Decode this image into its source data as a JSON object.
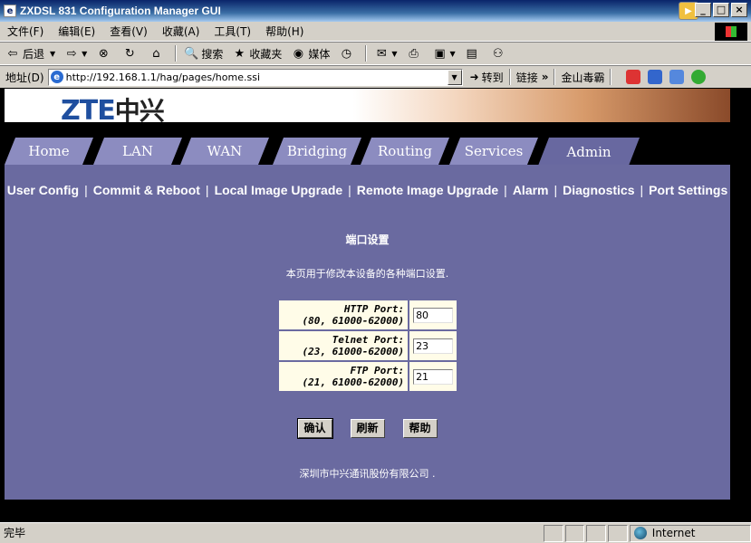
{
  "window": {
    "title": "ZXDSL 831 Configuration Manager GUI",
    "buttons": [
      "_",
      "□",
      "×"
    ]
  },
  "menubar": [
    "文件(F)",
    "编辑(E)",
    "查看(V)",
    "收藏(A)",
    "工具(T)",
    "帮助(H)"
  ],
  "toolbar": {
    "back": "后退",
    "search": "搜索",
    "favorites": "收藏夹",
    "media": "媒体"
  },
  "addressbar": {
    "label": "地址(D)",
    "url": "http://192.168.1.1/hag/pages/home.ssi",
    "go": "转到",
    "links": "链接",
    "jinshan": "金山毒霸"
  },
  "brand": {
    "logo_latin": "ZTE",
    "logo_cn": "中兴"
  },
  "tabs": [
    "Home",
    "LAN",
    "WAN",
    "Bridging",
    "Routing",
    "Services",
    "Admin"
  ],
  "active_tab": "Admin",
  "subnav": [
    "User Config",
    "Commit & Reboot",
    "Local Image Upgrade",
    "Remote Image Upgrade",
    "Alarm",
    "Diagnostics",
    "Port Settings"
  ],
  "page": {
    "title": "端口设置",
    "description": "本页用于修改本设备的各种端口设置.",
    "ports": [
      {
        "name": "HTTP Port:",
        "range": "(80, 61000-62000)",
        "value": "80"
      },
      {
        "name": "Telnet Port:",
        "range": "(23, 61000-62000)",
        "value": "23"
      },
      {
        "name": "FTP Port:",
        "range": "(21, 61000-62000)",
        "value": "21"
      }
    ],
    "buttons": {
      "confirm": "确认",
      "refresh": "刷新",
      "help": "帮助"
    },
    "footer": "深圳市中兴通讯股份有限公司 ."
  },
  "statusbar": {
    "status": "完毕",
    "zone": "Internet"
  },
  "colors": {
    "content_bg": "#6a6aa0",
    "tab_bg": "#8c8cc0",
    "brand_blue": "#1f4f9f"
  }
}
